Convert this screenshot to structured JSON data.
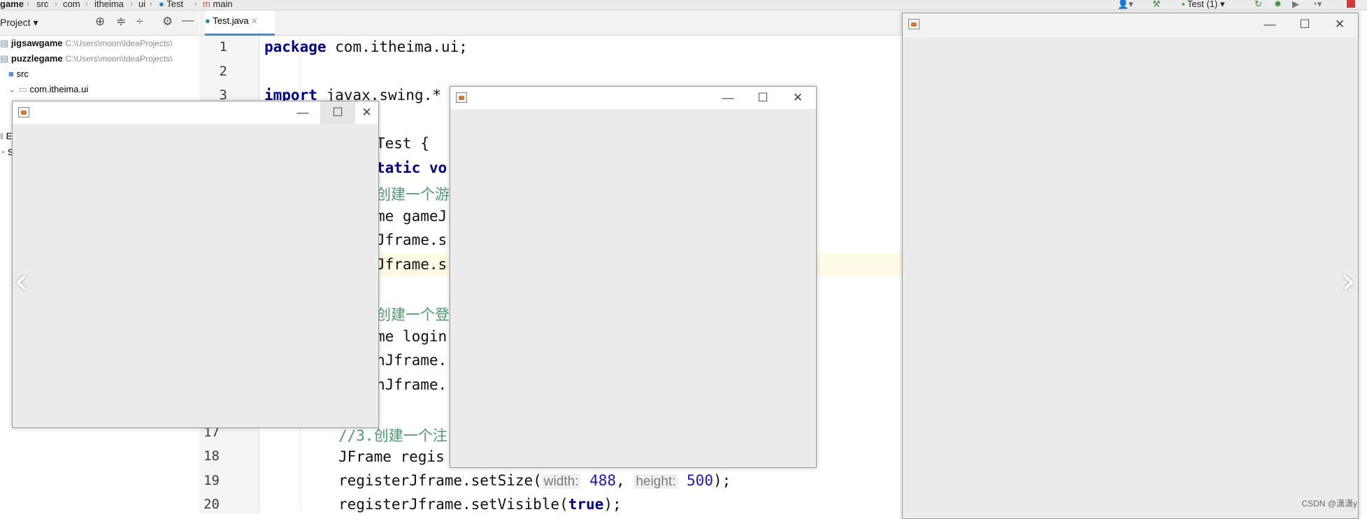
{
  "breadcrumb": {
    "items": [
      "game",
      "src",
      "com",
      "itheima",
      "ui",
      "Test",
      "main"
    ],
    "run_config": "Test (1)"
  },
  "project_panel": {
    "title": "Project",
    "items": [
      {
        "name": "jigsawgame",
        "path": "C:\\Users\\moon\\IdeaProjects\\"
      },
      {
        "name": "puzzlegame",
        "path": "C:\\Users\\moon\\IdeaProjects\\"
      },
      {
        "name": "src"
      },
      {
        "name": "com.itheima.ui"
      }
    ],
    "clipped_letters": [
      "E",
      "S"
    ]
  },
  "editor": {
    "tab_label": "Test.java",
    "line_numbers": [
      "1",
      "2",
      "3",
      "17",
      "18",
      "19",
      "20"
    ],
    "lines": {
      "l1_kw": "package",
      "l1_rest": " com.itheima.ui;",
      "l3_kw": "import",
      "l3_rest": " javax.swing.*",
      "frag_test": "Test {",
      "frag_static_kw": "tatic",
      "frag_static_rest": " vo",
      "frag_cm1": "创建一个游",
      "frag_me1": "me gameJ",
      "frag_jf1": "Jframe.s",
      "frag_jf2": "Jframe.s",
      "frag_cm2": "创建一个登",
      "frag_me2": "me login",
      "frag_nj1": "nJframe.",
      "frag_nj2": "nJframe.",
      "l17": "//3.创建一个注",
      "l18": "JFrame regis",
      "l19_a": "registerJframe.setSize(",
      "l19_hint_w": "width:",
      "l19_w": "488",
      "l19_sep": ", ",
      "l19_hint_h": "height:",
      "l19_h": "500",
      "l19_end": ");",
      "l20_a": "registerJframe.setVisible(",
      "l20_kw": "true",
      "l20_end": ");"
    }
  },
  "windows": {
    "minimize": "—",
    "maximize": "☐",
    "close": "✕"
  },
  "nav": {
    "prev": "‹",
    "next": "›"
  },
  "watermark": "CSDN @潇潇y",
  "colors": {
    "keyword": "#000080",
    "comment": "#4e9a6e",
    "number": "#1a1aa6"
  }
}
